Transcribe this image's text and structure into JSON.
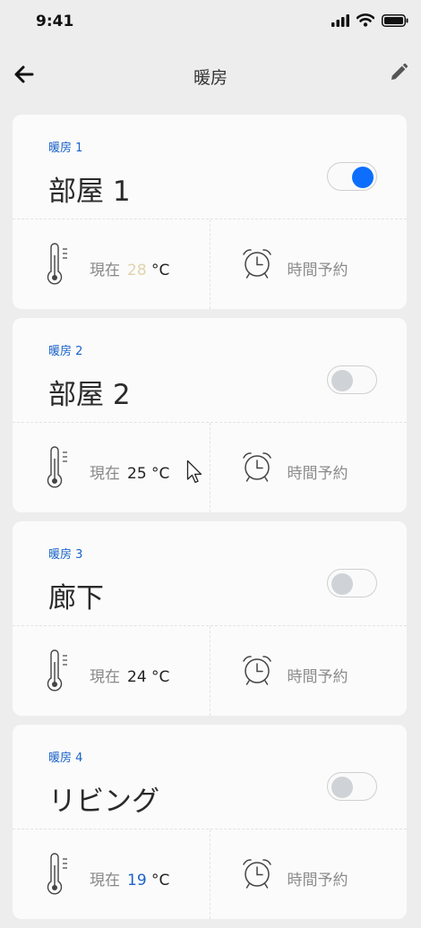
{
  "status_bar": {
    "time": "9:41"
  },
  "header": {
    "title": "暖房"
  },
  "colors": {
    "accent": "#0d6efd",
    "label_blue": "#1a63c9",
    "background": "#ededed",
    "card": "#fbfbfb"
  },
  "cards": [
    {
      "label": "暖房 1",
      "name": "部屋 1",
      "toggle_on": true,
      "current_label": "現在",
      "temperature": "28",
      "unit": "°C",
      "temp_color": "#e0d3b0",
      "schedule_label": "時間予約"
    },
    {
      "label": "暖房 2",
      "name": "部屋 2",
      "toggle_on": false,
      "current_label": "現在",
      "temperature": "25",
      "unit": "°C",
      "temp_color": "#222222",
      "schedule_label": "時間予約"
    },
    {
      "label": "暖房 3",
      "name": "廊下",
      "toggle_on": false,
      "current_label": "現在",
      "temperature": "24",
      "unit": "°C",
      "temp_color": "#222222",
      "schedule_label": "時間予約"
    },
    {
      "label": "暖房 4",
      "name": "リビング",
      "toggle_on": false,
      "current_label": "現在",
      "temperature": "19",
      "unit": "°C",
      "temp_color": "#1a63c9",
      "schedule_label": "時間予約"
    }
  ]
}
